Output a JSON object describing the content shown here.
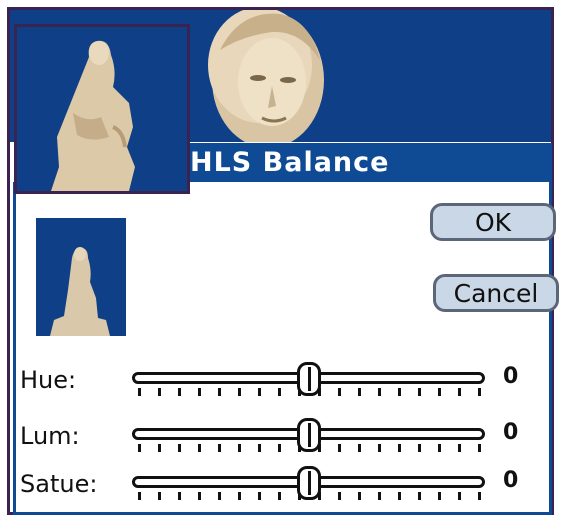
{
  "dialog": {
    "title": "HLS Balance",
    "ok_label": "OK",
    "cancel_label": "Cancel"
  },
  "sliders": [
    {
      "label": "Hue:",
      "value": "0",
      "position_fraction": 0.5
    },
    {
      "label": "Lum:",
      "value": "0",
      "position_fraction": 0.5
    },
    {
      "label": "Satue:",
      "value": "0",
      "position_fraction": 0.5
    }
  ],
  "colors": {
    "sky_blue": "#0f3f86",
    "titlebar_blue": "#0f4a94",
    "frame_purple": "#3a2350",
    "button_fill": "#c9d7e6"
  }
}
